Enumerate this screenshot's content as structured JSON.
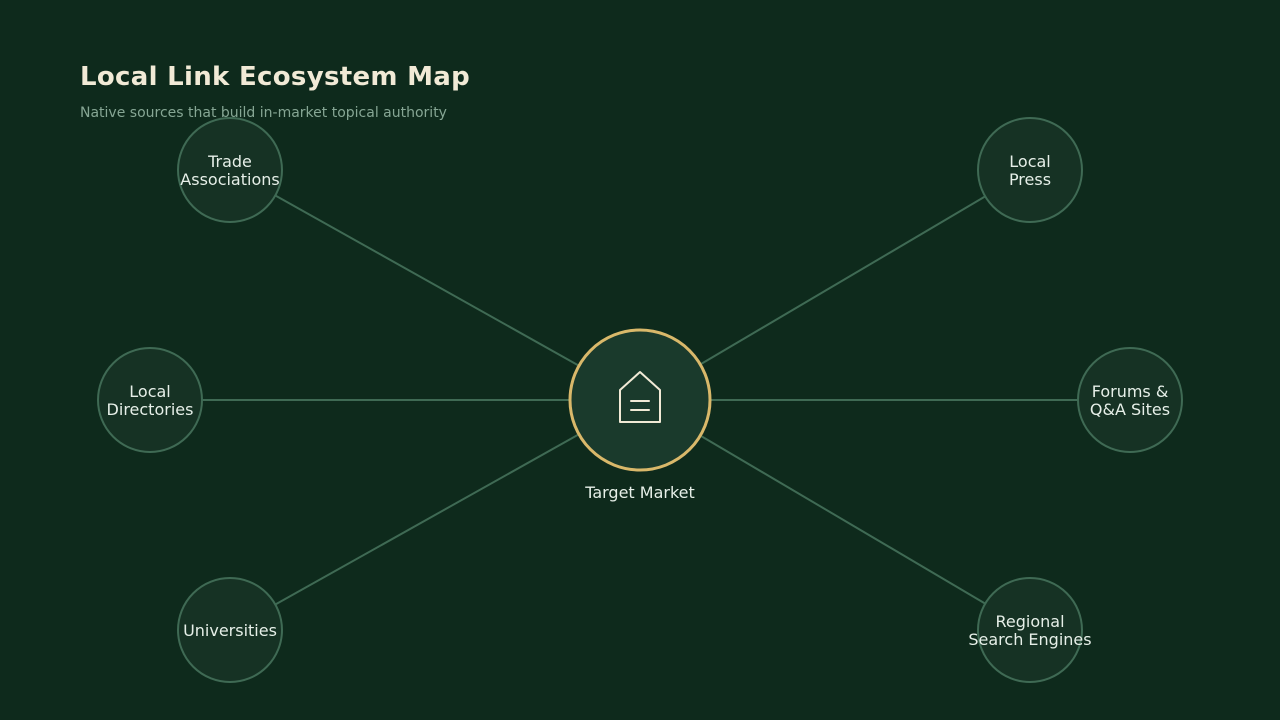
{
  "header": {
    "title": "Local Link Ecosystem Map",
    "subtitle": "Native sources that build in-market topical authority"
  },
  "hub": {
    "label": "Target Market",
    "icon": "house-icon"
  },
  "nodes": [
    {
      "id": "trade-associations",
      "lines": [
        "Trade",
        "Associations"
      ]
    },
    {
      "id": "local-press",
      "lines": [
        "Local",
        "Press"
      ]
    },
    {
      "id": "local-directories",
      "lines": [
        "Local",
        "Directories"
      ]
    },
    {
      "id": "forums-qa-sites",
      "lines": [
        "Forums &",
        "Q&A Sites"
      ]
    },
    {
      "id": "universities",
      "lines": [
        "Universities"
      ]
    },
    {
      "id": "regional-search-engines",
      "lines": [
        "Regional",
        "Search Engines"
      ]
    }
  ],
  "colors": {
    "background": "#0e2a1c",
    "node_fill": "#163224",
    "node_stroke": "#3f6a54",
    "connector": "#3f6a54",
    "hub_fill": "#1a3a2c",
    "hub_ring": "#d9b86a",
    "text": "#e6efe8",
    "title": "#f1ead6",
    "subtitle": "#86a694"
  }
}
